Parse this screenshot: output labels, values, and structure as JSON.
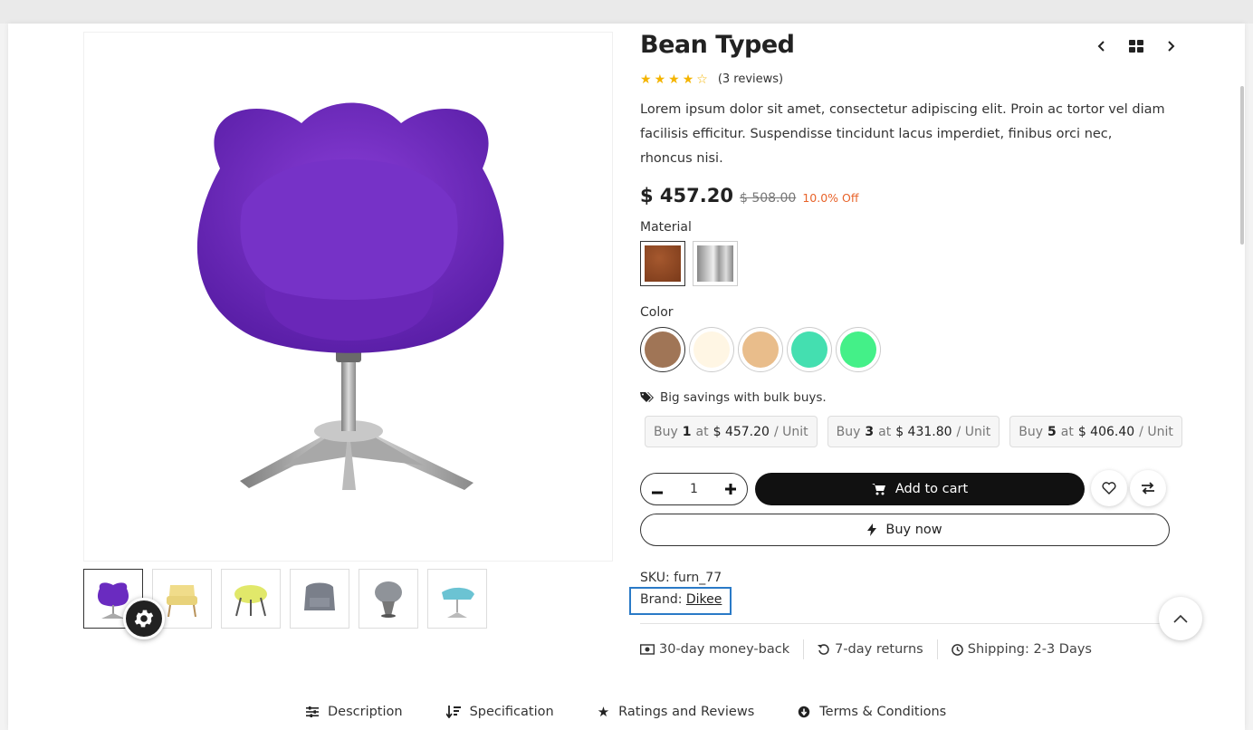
{
  "product": {
    "title": "Bean Typed",
    "rating": 3.5,
    "reviews_label": "(3 reviews)",
    "description": "Lorem ipsum dolor sit amet, consectetur adipiscing elit. Proin ac tortor vel diam facilisis efficitur. Suspendisse tincidunt lacus imperdiet, finibus orci nec, rhoncus nisi.",
    "price": "$ 457.20",
    "old_price": "$ 508.00",
    "discount": "10.0% Off"
  },
  "attributes": {
    "material_label": "Material",
    "materials": [
      {
        "name": "leather",
        "swatch": "#8a4522"
      },
      {
        "name": "steel",
        "swatch": "#b8b8b8"
      }
    ],
    "color_label": "Color",
    "colors": [
      "#a07556",
      "#fff6e4",
      "#e9bd8b",
      "#44dfb0",
      "#44f088"
    ]
  },
  "bulk": {
    "title": "Big savings with bulk buys.",
    "offers": [
      {
        "buy": "Buy",
        "qty": "1",
        "at": "at",
        "price": "$ 457.20",
        "unit": "/ Unit"
      },
      {
        "buy": "Buy",
        "qty": "3",
        "at": "at",
        "price": "$ 431.80",
        "unit": "/ Unit"
      },
      {
        "buy": "Buy",
        "qty": "5",
        "at": "at",
        "price": "$ 406.40",
        "unit": "/ Unit"
      }
    ]
  },
  "actions": {
    "quantity": "1",
    "add_to_cart": "Add to cart",
    "buy_now": "Buy now"
  },
  "meta": {
    "sku_label": "SKU:",
    "sku": "furn_77",
    "brand_label": "Brand:",
    "brand": "Dikee"
  },
  "policies": [
    {
      "icon": "money-icon",
      "label": "30-day money-back"
    },
    {
      "icon": "returns-icon",
      "label": "7-day returns"
    },
    {
      "icon": "clock-icon",
      "label": "Shipping: 2-3 Days"
    }
  ],
  "tabs": [
    {
      "icon": "sliders-icon",
      "label": "Description"
    },
    {
      "icon": "sort-icon",
      "label": "Specification"
    },
    {
      "icon": "star-icon",
      "label": "Ratings and Reviews"
    },
    {
      "icon": "arrow-circle-icon",
      "label": "Terms & Conditions"
    }
  ],
  "colors": {
    "accent_discount": "#e8632a",
    "star": "#f4b400",
    "highlight_box": "#2a7ac7"
  }
}
